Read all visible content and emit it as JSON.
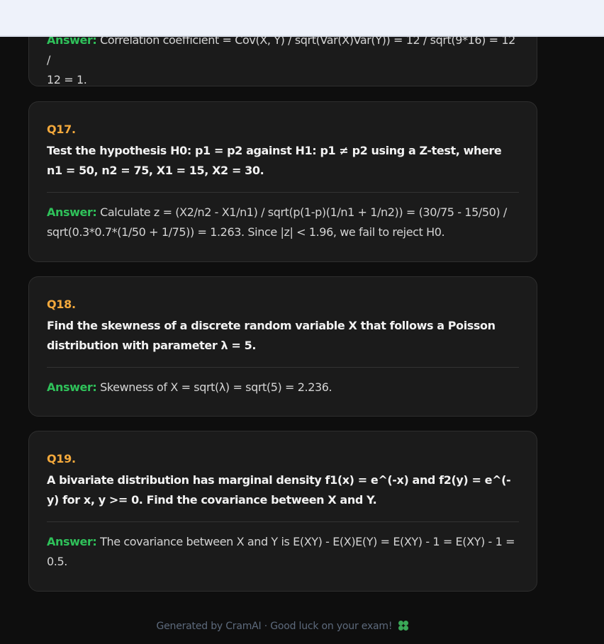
{
  "previous": {
    "answer_label": "Answer:",
    "answer_text_line1": "Correlation coefficient = Cov(X, Y) / sqrt(Var(X)Var(Y)) = 12 / sqrt(9*16) = 12 /",
    "answer_text_line2": "12 = 1."
  },
  "questions": [
    {
      "number": "Q17.",
      "text": "Test the hypothesis H0: p1 = p2 against H1: p1 ≠ p2 using a Z-test, where n1 = 50, n2 = 75, X1 = 15, X2 = 30.",
      "answer_label": "Answer:",
      "answer": "Calculate z = (X2/n2 - X1/n1) / sqrt(p(1-p)(1/n1 + 1/n2)) = (30/75 - 15/50) / sqrt(0.3*0.7*(1/50 + 1/75)) = 1.263. Since |z| < 1.96, we fail to reject H0."
    },
    {
      "number": "Q18.",
      "text": "Find the skewness of a discrete random variable X that follows a Poisson distribution with parameter λ = 5.",
      "answer_label": "Answer:",
      "answer": "Skewness of X = sqrt(λ) = sqrt(5) = 2.236."
    },
    {
      "number": "Q19.",
      "text": "A bivariate distribution has marginal density f1(x) = e^(-x) and f2(y) = e^(-y) for x, y >= 0. Find the covariance between X and Y.",
      "answer_label": "Answer:",
      "answer": "The covariance between X and Y is E(XY) - E(X)E(Y) = E(XY) - 1 = E(XY) - 1 = 0.5."
    }
  ],
  "footer": {
    "text": "Generated by CramAI · Good luck on your exam!",
    "icon": "four-leaf-clover-icon"
  },
  "colors": {
    "question_number": "#f4a93c",
    "answer_label": "#2fc15a",
    "card_background": "#1b1b1b",
    "page_background": "#0e0e0e"
  }
}
